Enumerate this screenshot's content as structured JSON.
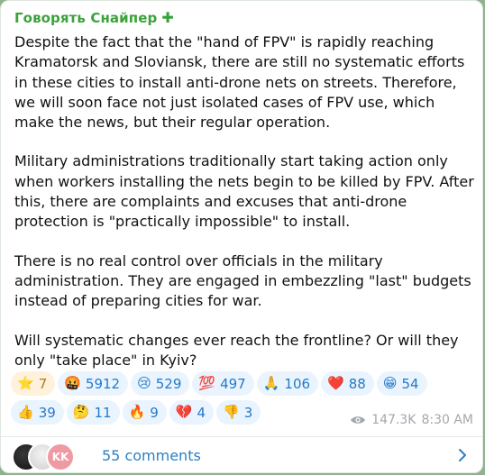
{
  "post": {
    "sender": "Говорять Снайпер",
    "sender_badge": "✚",
    "paragraphs": [
      "Despite the fact that the \"hand of FPV\" is rapidly reaching Kramatorsk and Sloviansk, there are still no systematic efforts in these cities to install anti-drone nets on streets. Therefore, we will soon face not just isolated cases of FPV use, which make the news, but their regular operation.",
      "Military administrations traditionally start taking action only when workers installing the nets begin to be killed by FPV. After this, there are complaints and excuses that anti-drone protection is \"practically impossible\" to install.",
      "There is no real control over officials in the military administration. They are engaged in embezzling \"last\" budgets instead of preparing cities for war.",
      "Will systematic changes ever reach the frontline? Or will they only \"take place\" in Kyiv?"
    ]
  },
  "reactions": {
    "row1": [
      {
        "emoji": "⭐",
        "count": "7",
        "icon": "star-icon"
      },
      {
        "emoji": "🤬",
        "count": "5912",
        "icon": "cursing-face-icon"
      },
      {
        "emoji": "😢",
        "count": "529",
        "icon": "crying-face-icon"
      },
      {
        "emoji": "💯",
        "count": "497",
        "icon": "hundred-points-icon"
      },
      {
        "emoji": "🙏",
        "count": "106",
        "icon": "folded-hands-icon"
      },
      {
        "emoji": "❤️",
        "count": "88",
        "icon": "red-heart-icon"
      },
      {
        "emoji": "😁",
        "count": "54",
        "icon": "grinning-face-icon"
      }
    ],
    "row2": [
      {
        "emoji": "👍",
        "count": "39",
        "icon": "thumbs-up-icon"
      },
      {
        "emoji": "🤔",
        "count": "11",
        "icon": "thinking-face-icon"
      },
      {
        "emoji": "🔥",
        "count": "9",
        "icon": "fire-icon"
      },
      {
        "emoji": "💔",
        "count": "4",
        "icon": "broken-heart-icon"
      },
      {
        "emoji": "👎",
        "count": "3",
        "icon": "thumbs-down-icon"
      }
    ]
  },
  "meta": {
    "views": "147.3K",
    "time": "8:30 AM"
  },
  "comments": {
    "label": "55 comments",
    "avatar_initials": "KK"
  },
  "colors": {
    "sender": "#3aa23a",
    "reaction_bg": "#e9f4ff",
    "reaction_text": "#2479c9",
    "own_reaction_bg": "#fff1dc",
    "link": "#2d7fc4",
    "meta": "#a3a8ad"
  }
}
